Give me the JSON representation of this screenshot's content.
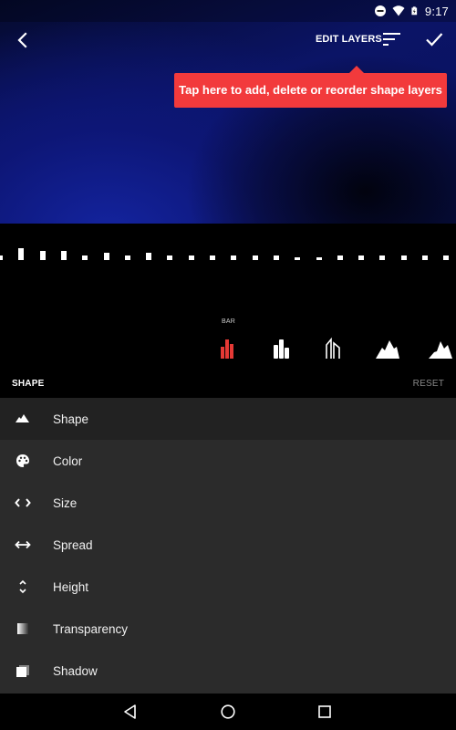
{
  "status_bar": {
    "time": "9:17",
    "icons": [
      "do-not-disturb-icon",
      "wifi-icon",
      "battery-charging-icon"
    ]
  },
  "toolbar": {
    "back_icon": "chevron-left-icon",
    "edit_layers_label": "EDIT LAYERS",
    "layers_icon": "sort-lines-icon",
    "done_icon": "check-icon"
  },
  "tooltip": {
    "text": "Tap here to add, delete or reorder shape layers",
    "color": "#f23a3c"
  },
  "visualizer": {
    "bar_levels": [
      2,
      5,
      4,
      4,
      2,
      3,
      2,
      3,
      2,
      2,
      2,
      2,
      2,
      2,
      1,
      1,
      2,
      2,
      2,
      2,
      2,
      2
    ],
    "max_level": 5
  },
  "shape_picker": {
    "selected_label": "BAR",
    "selected_index": 0,
    "accent_color": "#e53935",
    "options": [
      {
        "name": "bar",
        "icon": "bar-shape-icon"
      },
      {
        "name": "bar-rounded",
        "icon": "bar-rounded-shape-icon"
      },
      {
        "name": "line-peaks",
        "icon": "line-peaks-shape-icon"
      },
      {
        "name": "mountain",
        "icon": "mountain-shape-icon"
      },
      {
        "name": "mountain-smooth",
        "icon": "mountain-smooth-shape-icon"
      }
    ]
  },
  "section": {
    "title": "SHAPE",
    "reset_label": "RESET"
  },
  "menu": {
    "items": [
      {
        "label": "Shape",
        "icon": "mountain-icon",
        "active": true
      },
      {
        "label": "Color",
        "icon": "palette-icon",
        "active": false
      },
      {
        "label": "Size",
        "icon": "code-brackets-icon",
        "active": false
      },
      {
        "label": "Spread",
        "icon": "horizontal-arrows-icon",
        "active": false
      },
      {
        "label": "Height",
        "icon": "unfold-icon",
        "active": false
      },
      {
        "label": "Transparency",
        "icon": "gradient-square-icon",
        "active": false
      },
      {
        "label": "Shadow",
        "icon": "shadow-square-icon",
        "active": false
      }
    ]
  },
  "nav_bar": {
    "back_icon": "nav-back-triangle-icon",
    "home_icon": "nav-home-circle-icon",
    "recents_icon": "nav-recents-square-icon"
  }
}
